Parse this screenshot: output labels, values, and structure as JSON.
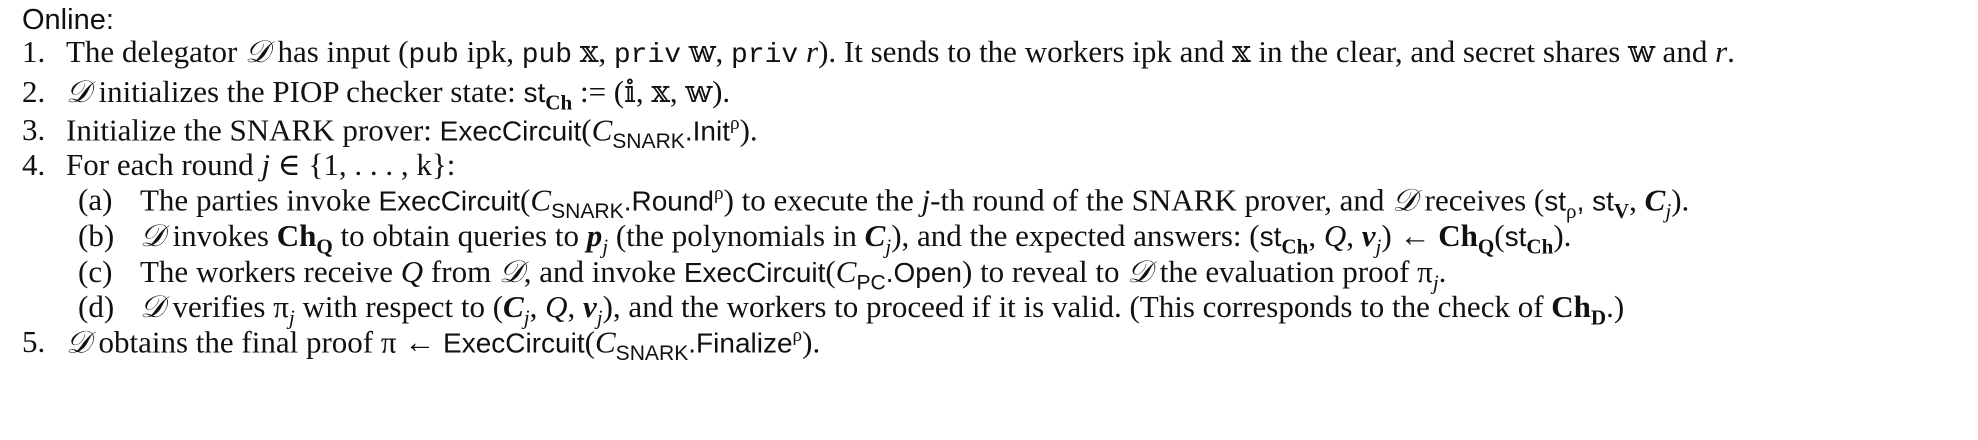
{
  "heading": "Online:",
  "steps": [
    {
      "num": "1.",
      "segments": [
        "The delegator ",
        "𝒟",
        " has input (",
        "pub",
        " ipk, ",
        "pub",
        " 𝕩, ",
        "priv",
        " 𝕨, ",
        "priv",
        " ",
        "r",
        "). It sends to the workers ipk and 𝕩 in the clear, and secret shares 𝕨 and ",
        "r",
        "."
      ]
    },
    {
      "num": "2.",
      "segments": [
        "𝒟",
        " initializes the PIOP checker state: ",
        "st",
        "Ch",
        " := (𝕚, 𝕩, 𝕨)."
      ]
    },
    {
      "num": "3.",
      "segments": [
        "Initialize the SNARK prover: ",
        "ExecCircuit",
        "(",
        "C",
        "SNARK",
        ".Init",
        "ρ",
        ")."
      ]
    },
    {
      "num": "4.",
      "segments": [
        "For each round ",
        "j",
        " ∈ {1, . . . , k}:"
      ]
    },
    {
      "num": "5.",
      "segments": [
        "𝒟",
        " obtains the final proof π ← ",
        "ExecCircuit",
        "(",
        "C",
        "SNARK",
        ".Finalize",
        "ρ",
        ")."
      ]
    }
  ],
  "substeps": [
    {
      "label": "(a)",
      "segments": [
        "The parties invoke ",
        "ExecCircuit",
        "(",
        "C",
        "SNARK",
        ".Round",
        "ρ",
        ") to execute the ",
        "j",
        "-th round of the SNARK prover, and ",
        "𝒟",
        " receives (",
        "st",
        "ρ",
        ", st",
        "V",
        ", ",
        "C",
        "j",
        ")."
      ]
    },
    {
      "label": "(b)",
      "segments": [
        "𝒟",
        " invokes ",
        "Ch",
        "Q",
        " to obtain queries to ",
        "p",
        "j",
        " (the polynomials in ",
        "C",
        "j",
        "), and the expected answers: (",
        "st",
        "Ch",
        ", ",
        "Q",
        ", ",
        "v",
        "j",
        ") ← ",
        "Ch",
        "Q",
        "(",
        "st",
        "Ch",
        ")."
      ]
    },
    {
      "label": "(c)",
      "segments": [
        "The workers receive ",
        "Q",
        " from ",
        "𝒟",
        ", and invoke ",
        "ExecCircuit",
        "(",
        "C",
        "PC",
        ".Open",
        ") to reveal to ",
        "𝒟",
        " the evaluation proof π",
        "j",
        "."
      ]
    },
    {
      "label": "(d)",
      "segments": [
        "𝒟",
        " verifies π",
        "j",
        " with respect to (",
        "C",
        "j",
        ", ",
        "Q",
        ", ",
        "v",
        "j",
        "), and the workers to proceed if it is valid. (This corresponds to the check of ",
        "Ch",
        "D",
        ".)"
      ]
    }
  ]
}
